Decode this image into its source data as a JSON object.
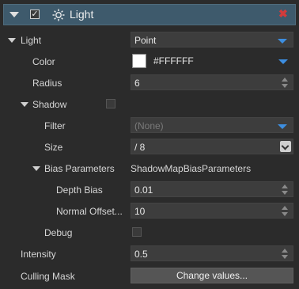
{
  "header": {
    "title": "Light",
    "enabled": true
  },
  "properties": {
    "light": {
      "label": "Light",
      "value": "Point"
    },
    "color": {
      "label": "Color",
      "value": "#FFFFFF",
      "swatch": "#ffffff"
    },
    "radius": {
      "label": "Radius",
      "value": "6"
    },
    "shadow": {
      "label": "Shadow",
      "enabled": false,
      "filter": {
        "label": "Filter",
        "value": "(None)"
      },
      "size": {
        "label": "Size",
        "value": "/ 8"
      },
      "bias": {
        "label": "Bias Parameters",
        "value": "ShadowMapBiasParameters",
        "depth_bias": {
          "label": "Depth Bias",
          "value": "0.01"
        },
        "normal_offset": {
          "label": "Normal Offset...",
          "value": "10"
        }
      },
      "debug": {
        "label": "Debug",
        "enabled": false
      }
    },
    "intensity": {
      "label": "Intensity",
      "value": "0.5"
    },
    "culling_mask": {
      "label": "Culling Mask",
      "button": "Change values..."
    }
  },
  "colors": {
    "header_bg": "#3e5a6c",
    "accent": "#3d8ee0",
    "close": "#d23b3b"
  }
}
